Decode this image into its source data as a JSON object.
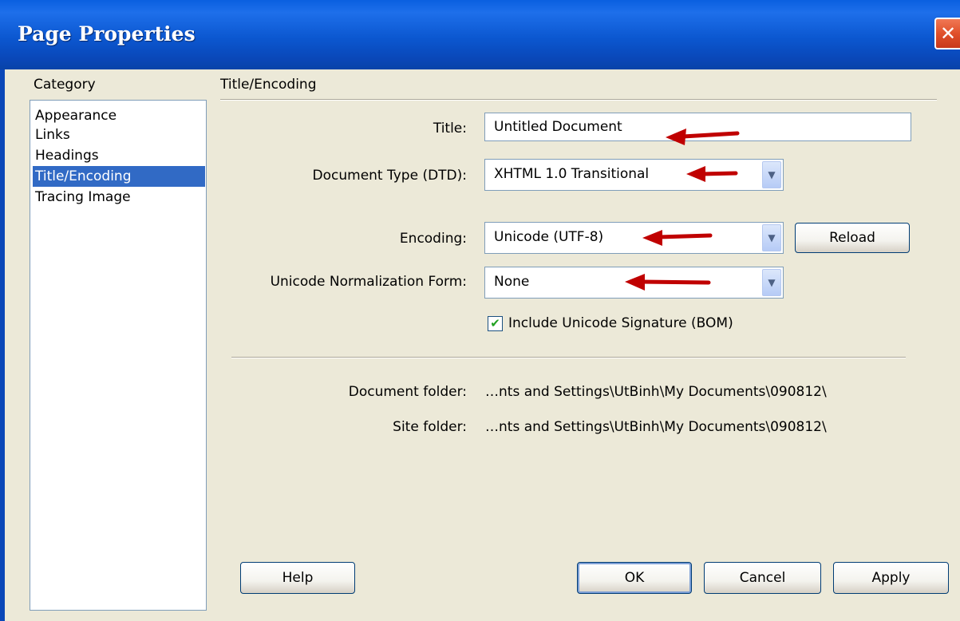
{
  "window": {
    "title": "Page Properties",
    "close_glyph": "✕"
  },
  "category": {
    "label": "Category",
    "items": [
      {
        "label": "Appearance",
        "selected": false
      },
      {
        "label": "Links",
        "selected": false
      },
      {
        "label": "Headings",
        "selected": false
      },
      {
        "label": "Title/Encoding",
        "selected": true
      },
      {
        "label": "Tracing Image",
        "selected": false
      }
    ]
  },
  "section": {
    "heading": "Title/Encoding"
  },
  "form": {
    "title_label": "Title:",
    "title_value": "Untitled Document",
    "doctype_label": "Document Type (DTD):",
    "doctype_value": "XHTML 1.0 Transitional",
    "encoding_label": "Encoding:",
    "encoding_value": "Unicode (UTF-8)",
    "reload_label": "Reload",
    "normalization_label": "Unicode Normalization Form:",
    "normalization_value": "None",
    "bom_label": "Include Unicode Signature (BOM)",
    "bom_checked": true,
    "checkmark_glyph": "✔",
    "dropdown_glyph": "▼"
  },
  "info": {
    "doc_folder_label": "Document folder:",
    "doc_folder_value": "…nts and Settings\\UtBinh\\My Documents\\090812\\",
    "site_folder_label": "Site folder:",
    "site_folder_value": "…nts and Settings\\UtBinh\\My Documents\\090812\\"
  },
  "buttons": {
    "help": "Help",
    "ok": "OK",
    "cancel": "Cancel",
    "apply": "Apply"
  },
  "colors": {
    "titlebar": "#0A57D0",
    "selection": "#316AC5",
    "annotation_arrow": "#C00000",
    "dialog_bg": "#ECE9D8"
  },
  "icons": {
    "close": "close-icon",
    "dropdown": "chevron-down-icon",
    "check": "checkmark-icon",
    "annotation": "red-arrow-icon"
  }
}
